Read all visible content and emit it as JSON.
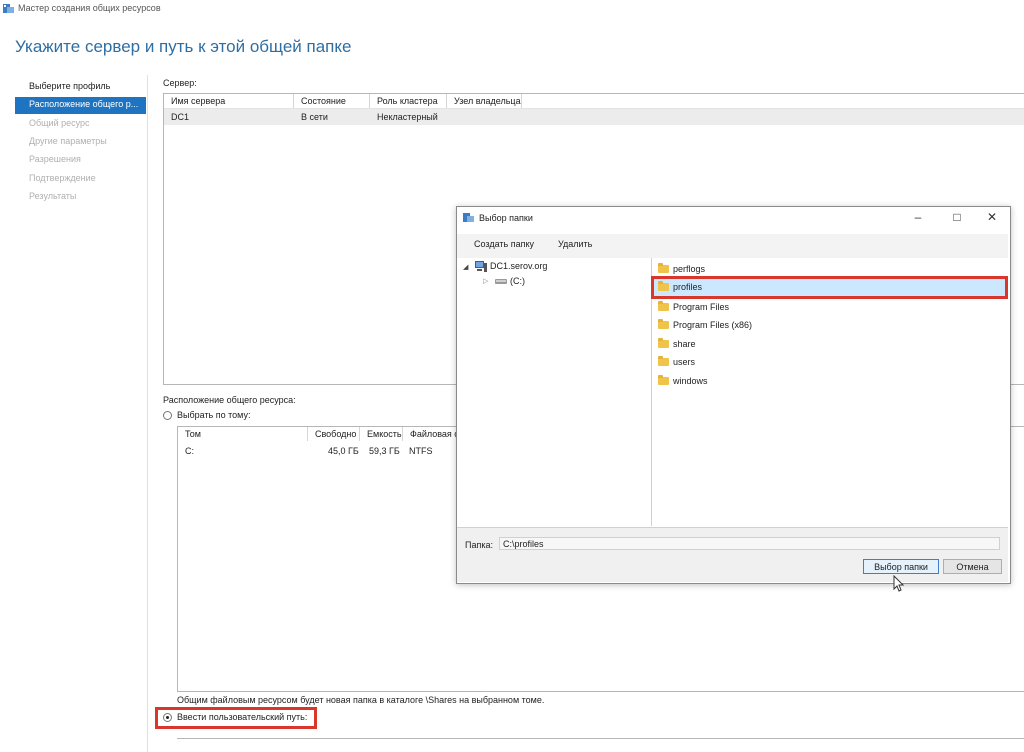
{
  "window": {
    "title": "Мастер создания общих ресурсов"
  },
  "heading": "Укажите сервер и путь к этой общей папке",
  "sidebar": {
    "items": [
      {
        "label": "Выберите профиль",
        "state": "normal"
      },
      {
        "label": "Расположение общего р...",
        "state": "active"
      },
      {
        "label": "Общий ресурс",
        "state": "disabled"
      },
      {
        "label": "Другие параметры",
        "state": "disabled"
      },
      {
        "label": "Разрешения",
        "state": "disabled"
      },
      {
        "label": "Подтверждение",
        "state": "disabled"
      },
      {
        "label": "Результаты",
        "state": "disabled"
      }
    ]
  },
  "server": {
    "label": "Сервер:",
    "columns": [
      "Имя сервера",
      "Состояние",
      "Роль кластера",
      "Узел владельца"
    ],
    "rows": [
      [
        "DC1",
        "В сети",
        "Некластерный",
        ""
      ]
    ]
  },
  "location": {
    "label": "Расположение общего ресурса:",
    "by_volume_label": "Выбрать по тому:",
    "columns": [
      "Том",
      "Свободно",
      "Емкость",
      "Файловая с"
    ],
    "rows": [
      [
        "C:",
        "45,0 ГБ",
        "59,3 ГБ",
        "NTFS"
      ]
    ],
    "note": "Общим файловым ресурсом будет новая папка в каталоге \\Shares на выбранном томе.",
    "custom_path_label": "Ввести пользовательский путь:"
  },
  "dialog": {
    "title": "Выбор папки",
    "toolbar": {
      "create": "Создать папку",
      "delete": "Удалить"
    },
    "tree": {
      "root": "DC1.serov.org",
      "child": "(C:)"
    },
    "folders": [
      "perflogs",
      "profiles",
      "Program Files",
      "Program Files (x86)",
      "share",
      "users",
      "windows"
    ],
    "selected_folder": "profiles",
    "path_label": "Папка:",
    "path_value": "C:\\profiles",
    "ok": "Выбор папки",
    "cancel": "Отмена"
  },
  "colors": {
    "accent": "#1f74c2",
    "heading": "#2f6ea3",
    "highlight": "#d9362c",
    "selection": "#cce8ff"
  }
}
